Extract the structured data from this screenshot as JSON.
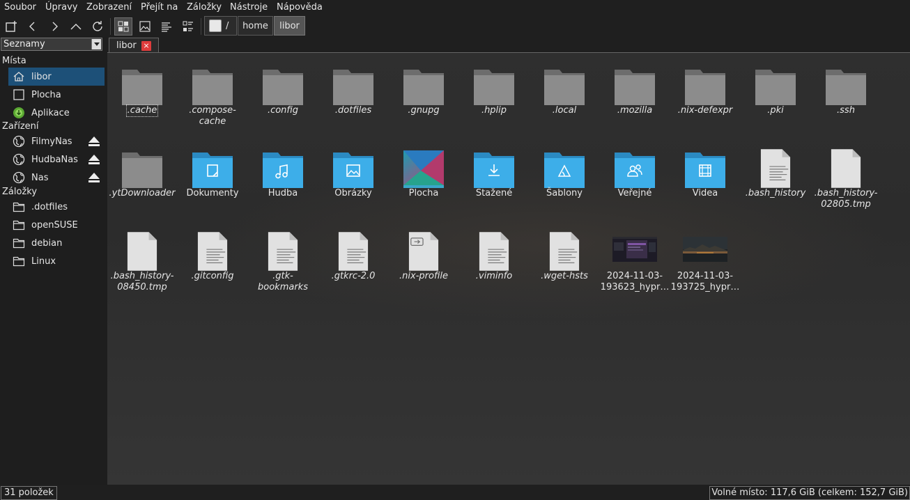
{
  "menu": {
    "items": [
      "Soubor",
      "Úpravy",
      "Zobrazení",
      "Přejít na",
      "Záložky",
      "Nástroje",
      "Nápověda"
    ]
  },
  "breadcrumb": {
    "root_label": "/",
    "segments": [
      "home",
      "libor"
    ]
  },
  "sidepane": {
    "selector_value": "Seznamy",
    "places_heading": "Místa",
    "places": [
      {
        "label": "libor",
        "icon": "home-icon",
        "selected": true
      },
      {
        "label": "Plocha",
        "icon": "desktop-icon"
      },
      {
        "label": "Aplikace",
        "icon": "applications-icon"
      }
    ],
    "devices_heading": "Zařízení",
    "devices": [
      {
        "label": "FilmyNas",
        "icon": "network-globe-icon"
      },
      {
        "label": "HudbaNas",
        "icon": "network-globe-icon"
      },
      {
        "label": "Nas",
        "icon": "network-globe-icon"
      }
    ],
    "bookmarks_heading": "Záložky",
    "bookmarks": [
      {
        "label": ".dotfiles",
        "icon": "folder-outline-icon"
      },
      {
        "label": "openSUSE",
        "icon": "folder-outline-icon"
      },
      {
        "label": "debian",
        "icon": "folder-outline-icon"
      },
      {
        "label": "Linux",
        "icon": "folder-outline-icon"
      }
    ]
  },
  "tab": {
    "label": "libor",
    "close_glyph": "×"
  },
  "files": [
    {
      "name": ".cache",
      "kind": "hidden-folder"
    },
    {
      "name": ".compose-cache",
      "kind": "hidden-folder"
    },
    {
      "name": ".config",
      "kind": "hidden-folder"
    },
    {
      "name": ".dotfiles",
      "kind": "hidden-folder"
    },
    {
      "name": ".gnupg",
      "kind": "hidden-folder"
    },
    {
      "name": ".hplip",
      "kind": "hidden-folder"
    },
    {
      "name": ".local",
      "kind": "hidden-folder"
    },
    {
      "name": ".mozilla",
      "kind": "hidden-folder"
    },
    {
      "name": ".nix-defexpr",
      "kind": "hidden-folder"
    },
    {
      "name": ".pki",
      "kind": "hidden-folder"
    },
    {
      "name": ".ssh",
      "kind": "hidden-folder"
    },
    {
      "name": ".ytDownloader",
      "kind": "hidden-folder"
    },
    {
      "name": "Dokumenty",
      "kind": "folder-documents"
    },
    {
      "name": "Hudba",
      "kind": "folder-music"
    },
    {
      "name": "Obrázky",
      "kind": "folder-pictures"
    },
    {
      "name": "Plocha",
      "kind": "desktop"
    },
    {
      "name": "Stažené",
      "kind": "folder-downloads"
    },
    {
      "name": "Šablony",
      "kind": "folder-templates"
    },
    {
      "name": "Veřejné",
      "kind": "folder-public"
    },
    {
      "name": "Videa",
      "kind": "folder-videos"
    },
    {
      "name": ".bash_history",
      "kind": "text-file"
    },
    {
      "name": ".bash_history-02805.tmp",
      "kind": "blank-file"
    },
    {
      "name": ".bash_history-08450.tmp",
      "kind": "blank-file"
    },
    {
      "name": ".gitconfig",
      "kind": "text-file"
    },
    {
      "name": ".gtk-bookmarks",
      "kind": "text-file"
    },
    {
      "name": ".gtkrc-2.0",
      "kind": "text-file"
    },
    {
      "name": ".nix-profile",
      "kind": "link-file"
    },
    {
      "name": ".viminfo",
      "kind": "text-file"
    },
    {
      "name": ".wget-hsts",
      "kind": "text-file"
    },
    {
      "name": "2024-11-03-193623_hypr…",
      "kind": "screenshot-dark"
    },
    {
      "name": "2024-11-03-193725_hypr…",
      "kind": "screenshot-landscape"
    }
  ],
  "status": {
    "count": "31 položek",
    "free_space": "Volné místo: 117,6 GiB (celkem: 152,7 GiB)"
  },
  "colors": {
    "accent": "#1d5078",
    "folder_blue": "#3daee9",
    "folder_gray": "#8a8a8a"
  }
}
